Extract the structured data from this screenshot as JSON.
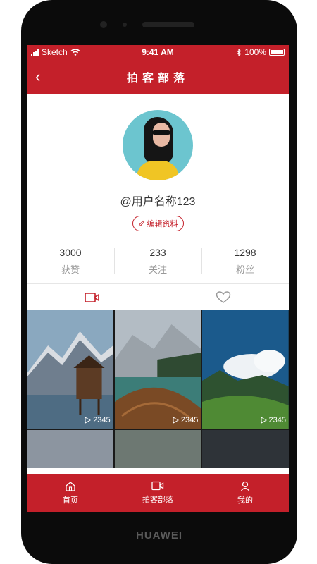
{
  "device": {
    "brand": "HUAWEI"
  },
  "statusbar": {
    "carrier": "Sketch",
    "time": "9:41 AM",
    "battery": "100%"
  },
  "navbar": {
    "back_glyph": "‹",
    "title": "拍客部落"
  },
  "profile": {
    "username": "@用户名称123",
    "edit_label": "编辑资料",
    "stats": [
      {
        "value": "3000",
        "label": "获赞"
      },
      {
        "value": "233",
        "label": "关注"
      },
      {
        "value": "1298",
        "label": "粉丝"
      }
    ]
  },
  "tabs": [
    {
      "icon": "video-icon",
      "active": true
    },
    {
      "icon": "heart-icon",
      "active": false
    }
  ],
  "videos": [
    {
      "plays": "2345",
      "scene": "mountain-cabin-lake"
    },
    {
      "plays": "2345",
      "scene": "boat-on-mountain-lake"
    },
    {
      "plays": "2345",
      "scene": "green-valley-clouds"
    },
    {
      "scene": "misty-forest"
    },
    {
      "scene": "rock-cliffs"
    },
    {
      "scene": "dark-mountains"
    }
  ],
  "tabbar": [
    {
      "label": "首页",
      "icon": "home-icon"
    },
    {
      "label": "拍客部落",
      "icon": "video-icon"
    },
    {
      "label": "我的",
      "icon": "user-icon"
    }
  ],
  "colors": {
    "accent": "#c4202a",
    "text": "#333333",
    "muted": "#999999"
  }
}
